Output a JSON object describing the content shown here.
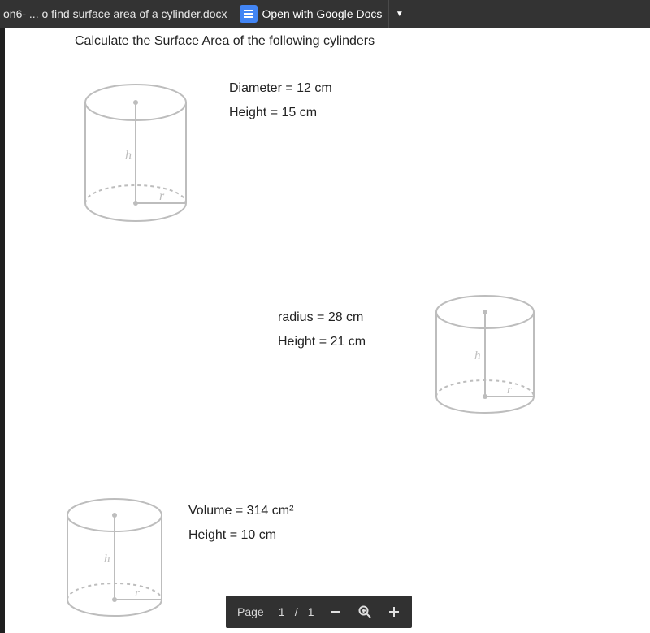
{
  "topbar": {
    "filename": "on6- ... o find surface area of a cylinder.docx",
    "open_label": "Open with Google Docs"
  },
  "doc": {
    "heading": "Calculate the Surface Area of the following cylinders",
    "p1": {
      "l1": "Diameter = 12 cm",
      "l2": "Height = 15 cm"
    },
    "p2": {
      "l1": "radius = 28 cm",
      "l2": "Height = 21 cm"
    },
    "p3": {
      "l1": "Volume = 314 cm²",
      "l2": "Height = 10 cm"
    }
  },
  "toolbar": {
    "page_label": "Page",
    "current": "1",
    "slash": "/",
    "total": "1"
  },
  "glyph": {
    "h": "h",
    "r": "r"
  }
}
